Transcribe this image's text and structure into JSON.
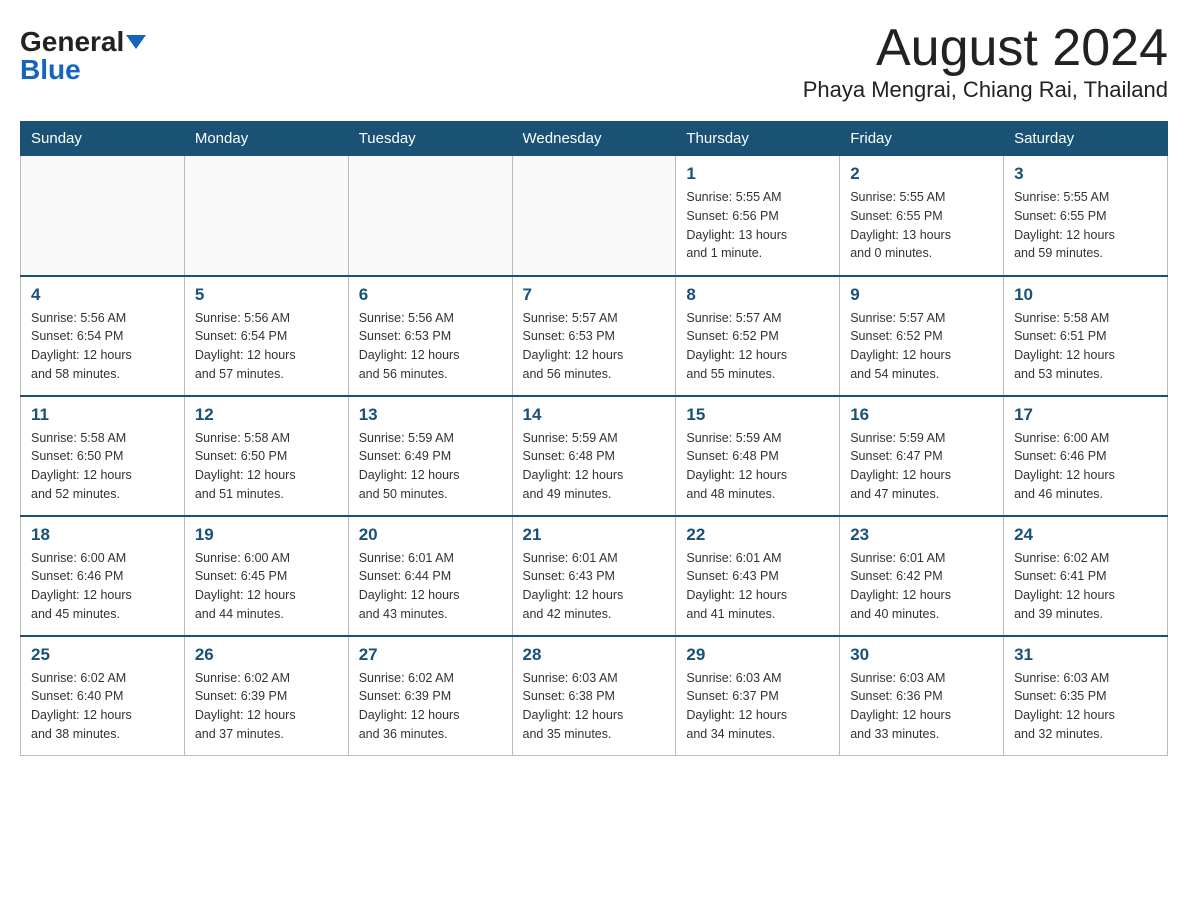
{
  "header": {
    "logo_general": "General",
    "logo_blue": "Blue",
    "month_title": "August 2024",
    "location": "Phaya Mengrai, Chiang Rai, Thailand"
  },
  "weekdays": [
    "Sunday",
    "Monday",
    "Tuesday",
    "Wednesday",
    "Thursday",
    "Friday",
    "Saturday"
  ],
  "weeks": [
    [
      {
        "day": "",
        "info": ""
      },
      {
        "day": "",
        "info": ""
      },
      {
        "day": "",
        "info": ""
      },
      {
        "day": "",
        "info": ""
      },
      {
        "day": "1",
        "info": "Sunrise: 5:55 AM\nSunset: 6:56 PM\nDaylight: 13 hours\nand 1 minute."
      },
      {
        "day": "2",
        "info": "Sunrise: 5:55 AM\nSunset: 6:55 PM\nDaylight: 13 hours\nand 0 minutes."
      },
      {
        "day": "3",
        "info": "Sunrise: 5:55 AM\nSunset: 6:55 PM\nDaylight: 12 hours\nand 59 minutes."
      }
    ],
    [
      {
        "day": "4",
        "info": "Sunrise: 5:56 AM\nSunset: 6:54 PM\nDaylight: 12 hours\nand 58 minutes."
      },
      {
        "day": "5",
        "info": "Sunrise: 5:56 AM\nSunset: 6:54 PM\nDaylight: 12 hours\nand 57 minutes."
      },
      {
        "day": "6",
        "info": "Sunrise: 5:56 AM\nSunset: 6:53 PM\nDaylight: 12 hours\nand 56 minutes."
      },
      {
        "day": "7",
        "info": "Sunrise: 5:57 AM\nSunset: 6:53 PM\nDaylight: 12 hours\nand 56 minutes."
      },
      {
        "day": "8",
        "info": "Sunrise: 5:57 AM\nSunset: 6:52 PM\nDaylight: 12 hours\nand 55 minutes."
      },
      {
        "day": "9",
        "info": "Sunrise: 5:57 AM\nSunset: 6:52 PM\nDaylight: 12 hours\nand 54 minutes."
      },
      {
        "day": "10",
        "info": "Sunrise: 5:58 AM\nSunset: 6:51 PM\nDaylight: 12 hours\nand 53 minutes."
      }
    ],
    [
      {
        "day": "11",
        "info": "Sunrise: 5:58 AM\nSunset: 6:50 PM\nDaylight: 12 hours\nand 52 minutes."
      },
      {
        "day": "12",
        "info": "Sunrise: 5:58 AM\nSunset: 6:50 PM\nDaylight: 12 hours\nand 51 minutes."
      },
      {
        "day": "13",
        "info": "Sunrise: 5:59 AM\nSunset: 6:49 PM\nDaylight: 12 hours\nand 50 minutes."
      },
      {
        "day": "14",
        "info": "Sunrise: 5:59 AM\nSunset: 6:48 PM\nDaylight: 12 hours\nand 49 minutes."
      },
      {
        "day": "15",
        "info": "Sunrise: 5:59 AM\nSunset: 6:48 PM\nDaylight: 12 hours\nand 48 minutes."
      },
      {
        "day": "16",
        "info": "Sunrise: 5:59 AM\nSunset: 6:47 PM\nDaylight: 12 hours\nand 47 minutes."
      },
      {
        "day": "17",
        "info": "Sunrise: 6:00 AM\nSunset: 6:46 PM\nDaylight: 12 hours\nand 46 minutes."
      }
    ],
    [
      {
        "day": "18",
        "info": "Sunrise: 6:00 AM\nSunset: 6:46 PM\nDaylight: 12 hours\nand 45 minutes."
      },
      {
        "day": "19",
        "info": "Sunrise: 6:00 AM\nSunset: 6:45 PM\nDaylight: 12 hours\nand 44 minutes."
      },
      {
        "day": "20",
        "info": "Sunrise: 6:01 AM\nSunset: 6:44 PM\nDaylight: 12 hours\nand 43 minutes."
      },
      {
        "day": "21",
        "info": "Sunrise: 6:01 AM\nSunset: 6:43 PM\nDaylight: 12 hours\nand 42 minutes."
      },
      {
        "day": "22",
        "info": "Sunrise: 6:01 AM\nSunset: 6:43 PM\nDaylight: 12 hours\nand 41 minutes."
      },
      {
        "day": "23",
        "info": "Sunrise: 6:01 AM\nSunset: 6:42 PM\nDaylight: 12 hours\nand 40 minutes."
      },
      {
        "day": "24",
        "info": "Sunrise: 6:02 AM\nSunset: 6:41 PM\nDaylight: 12 hours\nand 39 minutes."
      }
    ],
    [
      {
        "day": "25",
        "info": "Sunrise: 6:02 AM\nSunset: 6:40 PM\nDaylight: 12 hours\nand 38 minutes."
      },
      {
        "day": "26",
        "info": "Sunrise: 6:02 AM\nSunset: 6:39 PM\nDaylight: 12 hours\nand 37 minutes."
      },
      {
        "day": "27",
        "info": "Sunrise: 6:02 AM\nSunset: 6:39 PM\nDaylight: 12 hours\nand 36 minutes."
      },
      {
        "day": "28",
        "info": "Sunrise: 6:03 AM\nSunset: 6:38 PM\nDaylight: 12 hours\nand 35 minutes."
      },
      {
        "day": "29",
        "info": "Sunrise: 6:03 AM\nSunset: 6:37 PM\nDaylight: 12 hours\nand 34 minutes."
      },
      {
        "day": "30",
        "info": "Sunrise: 6:03 AM\nSunset: 6:36 PM\nDaylight: 12 hours\nand 33 minutes."
      },
      {
        "day": "31",
        "info": "Sunrise: 6:03 AM\nSunset: 6:35 PM\nDaylight: 12 hours\nand 32 minutes."
      }
    ]
  ]
}
